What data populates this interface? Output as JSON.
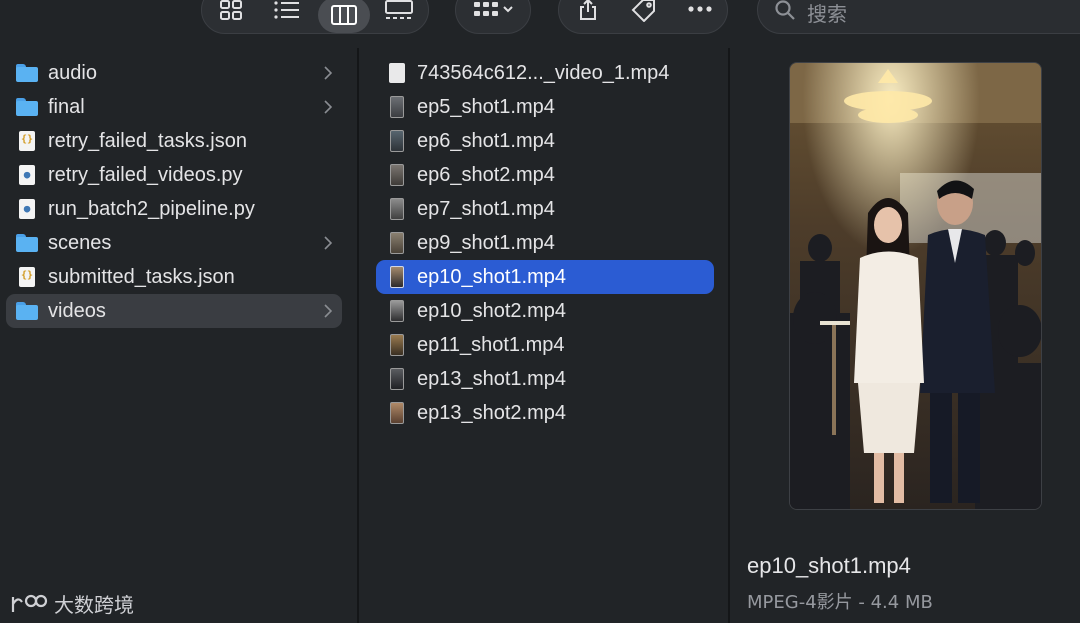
{
  "toolbar": {
    "buttons": [
      {
        "name": "icon-view",
        "icon": "grid-icon"
      },
      {
        "name": "list-view",
        "icon": "list-icon"
      },
      {
        "name": "column-view",
        "icon": "columns-icon",
        "active": true
      },
      {
        "name": "gallery-view",
        "icon": "gallery-icon"
      },
      {
        "name": "group-menu",
        "icon": "group-grid-icon"
      },
      {
        "name": "share",
        "icon": "share-icon"
      },
      {
        "name": "tag",
        "icon": "tag-icon"
      },
      {
        "name": "more",
        "icon": "ellipsis-icon"
      }
    ],
    "search_placeholder": "搜索"
  },
  "column1": {
    "items": [
      {
        "label": "audio",
        "kind": "folder",
        "has_children": true
      },
      {
        "label": "final",
        "kind": "folder",
        "has_children": true
      },
      {
        "label": "retry_failed_tasks.json",
        "kind": "json"
      },
      {
        "label": "retry_failed_videos.py",
        "kind": "python"
      },
      {
        "label": "run_batch2_pipeline.py",
        "kind": "python"
      },
      {
        "label": "scenes",
        "kind": "folder",
        "has_children": true
      },
      {
        "label": "submitted_tasks.json",
        "kind": "json"
      },
      {
        "label": "videos",
        "kind": "folder",
        "has_children": true,
        "selected": true
      }
    ]
  },
  "column2": {
    "items": [
      {
        "label": "743564c612..._video_1.mp4",
        "kind": "generic"
      },
      {
        "label": "ep5_shot1.mp4",
        "kind": "video"
      },
      {
        "label": "ep6_shot1.mp4",
        "kind": "video"
      },
      {
        "label": "ep6_shot2.mp4",
        "kind": "video"
      },
      {
        "label": "ep7_shot1.mp4",
        "kind": "video"
      },
      {
        "label": "ep9_shot1.mp4",
        "kind": "video"
      },
      {
        "label": "ep10_shot1.mp4",
        "kind": "video",
        "selected": true
      },
      {
        "label": "ep10_shot2.mp4",
        "kind": "video"
      },
      {
        "label": "ep11_shot1.mp4",
        "kind": "video"
      },
      {
        "label": "ep13_shot1.mp4",
        "kind": "video"
      },
      {
        "label": "ep13_shot2.mp4",
        "kind": "video"
      }
    ]
  },
  "preview": {
    "file_name": "ep10_shot1.mp4",
    "meta": "MPEG-4影片 - 4.4 MB"
  },
  "watermark": {
    "text": "大数跨境"
  },
  "colors": {
    "selection_blue": "#2b5cd3",
    "folder_blue": "#5ab2f2",
    "window_bg": "#212427"
  }
}
